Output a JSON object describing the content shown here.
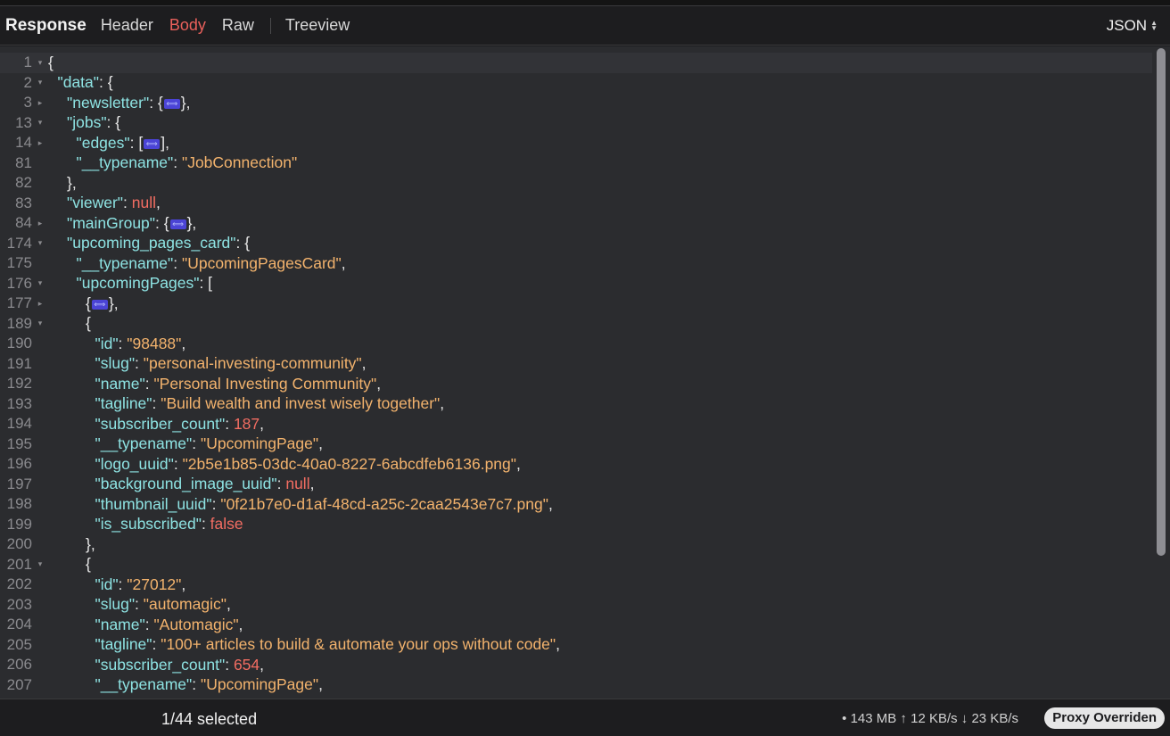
{
  "header": {
    "title": "Response",
    "tabs": [
      "Header",
      "Body",
      "Raw",
      "Treeview"
    ],
    "active_tab": "Body",
    "format": "JSON"
  },
  "editor": {
    "lines": [
      {
        "n": "1",
        "fold": "▾",
        "indent": 0,
        "tokens": [
          [
            "p",
            "{"
          ]
        ]
      },
      {
        "n": "2",
        "fold": "▾",
        "indent": 1,
        "tokens": [
          [
            "k",
            "\"data\""
          ],
          [
            "p",
            ": {"
          ]
        ]
      },
      {
        "n": "3",
        "fold": "▸",
        "indent": 2,
        "tokens": [
          [
            "k",
            "\"newsletter\""
          ],
          [
            "p",
            ": {"
          ],
          [
            "c",
            ""
          ],
          [
            "p",
            "},"
          ]
        ]
      },
      {
        "n": "13",
        "fold": "▾",
        "indent": 2,
        "tokens": [
          [
            "k",
            "\"jobs\""
          ],
          [
            "p",
            ": {"
          ]
        ]
      },
      {
        "n": "14",
        "fold": "▸",
        "indent": 3,
        "tokens": [
          [
            "k",
            "\"edges\""
          ],
          [
            "p",
            ": ["
          ],
          [
            "c",
            ""
          ],
          [
            "p",
            "],"
          ]
        ]
      },
      {
        "n": "81",
        "fold": "",
        "indent": 3,
        "tokens": [
          [
            "k",
            "\"__typename\""
          ],
          [
            "p",
            ": "
          ],
          [
            "s",
            "\"JobConnection\""
          ]
        ]
      },
      {
        "n": "82",
        "fold": "",
        "indent": 2,
        "tokens": [
          [
            "p",
            "},"
          ]
        ]
      },
      {
        "n": "83",
        "fold": "",
        "indent": 2,
        "tokens": [
          [
            "k",
            "\"viewer\""
          ],
          [
            "p",
            ": "
          ],
          [
            "n",
            "null"
          ],
          [
            "p",
            ","
          ]
        ]
      },
      {
        "n": "84",
        "fold": "▸",
        "indent": 2,
        "tokens": [
          [
            "k",
            "\"mainGroup\""
          ],
          [
            "p",
            ": {"
          ],
          [
            "c",
            ""
          ],
          [
            "p",
            "},"
          ]
        ]
      },
      {
        "n": "174",
        "fold": "▾",
        "indent": 2,
        "tokens": [
          [
            "k",
            "\"upcoming_pages_card\""
          ],
          [
            "p",
            ": {"
          ]
        ]
      },
      {
        "n": "175",
        "fold": "",
        "indent": 3,
        "tokens": [
          [
            "k",
            "\"__typename\""
          ],
          [
            "p",
            ": "
          ],
          [
            "s",
            "\"UpcomingPagesCard\""
          ],
          [
            "p",
            ","
          ]
        ]
      },
      {
        "n": "176",
        "fold": "▾",
        "indent": 3,
        "tokens": [
          [
            "k",
            "\"upcomingPages\""
          ],
          [
            "p",
            ": ["
          ]
        ]
      },
      {
        "n": "177",
        "fold": "▸",
        "indent": 4,
        "tokens": [
          [
            "p",
            "{"
          ],
          [
            "c",
            ""
          ],
          [
            "p",
            "},"
          ]
        ]
      },
      {
        "n": "189",
        "fold": "▾",
        "indent": 4,
        "tokens": [
          [
            "p",
            "{"
          ]
        ]
      },
      {
        "n": "190",
        "fold": "",
        "indent": 5,
        "tokens": [
          [
            "k",
            "\"id\""
          ],
          [
            "p",
            ": "
          ],
          [
            "s",
            "\"98488\""
          ],
          [
            "p",
            ","
          ]
        ]
      },
      {
        "n": "191",
        "fold": "",
        "indent": 5,
        "tokens": [
          [
            "k",
            "\"slug\""
          ],
          [
            "p",
            ": "
          ],
          [
            "s",
            "\"personal-investing-community\""
          ],
          [
            "p",
            ","
          ]
        ]
      },
      {
        "n": "192",
        "fold": "",
        "indent": 5,
        "tokens": [
          [
            "k",
            "\"name\""
          ],
          [
            "p",
            ": "
          ],
          [
            "s",
            "\"Personal Investing Community\""
          ],
          [
            "p",
            ","
          ]
        ]
      },
      {
        "n": "193",
        "fold": "",
        "indent": 5,
        "tokens": [
          [
            "k",
            "\"tagline\""
          ],
          [
            "p",
            ": "
          ],
          [
            "s",
            "\"Build wealth and invest wisely together\""
          ],
          [
            "p",
            ","
          ]
        ]
      },
      {
        "n": "194",
        "fold": "",
        "indent": 5,
        "tokens": [
          [
            "k",
            "\"subscriber_count\""
          ],
          [
            "p",
            ": "
          ],
          [
            "n",
            "187"
          ],
          [
            "p",
            ","
          ]
        ]
      },
      {
        "n": "195",
        "fold": "",
        "indent": 5,
        "tokens": [
          [
            "k",
            "\"__typename\""
          ],
          [
            "p",
            ": "
          ],
          [
            "s",
            "\"UpcomingPage\""
          ],
          [
            "p",
            ","
          ]
        ]
      },
      {
        "n": "196",
        "fold": "",
        "indent": 5,
        "tokens": [
          [
            "k",
            "\"logo_uuid\""
          ],
          [
            "p",
            ": "
          ],
          [
            "s",
            "\"2b5e1b85-03dc-40a0-8227-6abcdfeb6136.png\""
          ],
          [
            "p",
            ","
          ]
        ]
      },
      {
        "n": "197",
        "fold": "",
        "indent": 5,
        "tokens": [
          [
            "k",
            "\"background_image_uuid\""
          ],
          [
            "p",
            ": "
          ],
          [
            "n",
            "null"
          ],
          [
            "p",
            ","
          ]
        ]
      },
      {
        "n": "198",
        "fold": "",
        "indent": 5,
        "tokens": [
          [
            "k",
            "\"thumbnail_uuid\""
          ],
          [
            "p",
            ": "
          ],
          [
            "s",
            "\"0f21b7e0-d1af-48cd-a25c-2caa2543e7c7.png\""
          ],
          [
            "p",
            ","
          ]
        ]
      },
      {
        "n": "199",
        "fold": "",
        "indent": 5,
        "tokens": [
          [
            "k",
            "\"is_subscribed\""
          ],
          [
            "p",
            ": "
          ],
          [
            "n",
            "false"
          ]
        ]
      },
      {
        "n": "200",
        "fold": "",
        "indent": 4,
        "tokens": [
          [
            "p",
            "},"
          ]
        ]
      },
      {
        "n": "201",
        "fold": "▾",
        "indent": 4,
        "tokens": [
          [
            "p",
            "{"
          ]
        ]
      },
      {
        "n": "202",
        "fold": "",
        "indent": 5,
        "tokens": [
          [
            "k",
            "\"id\""
          ],
          [
            "p",
            ": "
          ],
          [
            "s",
            "\"27012\""
          ],
          [
            "p",
            ","
          ]
        ]
      },
      {
        "n": "203",
        "fold": "",
        "indent": 5,
        "tokens": [
          [
            "k",
            "\"slug\""
          ],
          [
            "p",
            ": "
          ],
          [
            "s",
            "\"automagic\""
          ],
          [
            "p",
            ","
          ]
        ]
      },
      {
        "n": "204",
        "fold": "",
        "indent": 5,
        "tokens": [
          [
            "k",
            "\"name\""
          ],
          [
            "p",
            ": "
          ],
          [
            "s",
            "\"Automagic\""
          ],
          [
            "p",
            ","
          ]
        ]
      },
      {
        "n": "205",
        "fold": "",
        "indent": 5,
        "tokens": [
          [
            "k",
            "\"tagline\""
          ],
          [
            "p",
            ": "
          ],
          [
            "s",
            "\"100+ articles to build & automate your ops without code\""
          ],
          [
            "p",
            ","
          ]
        ]
      },
      {
        "n": "206",
        "fold": "",
        "indent": 5,
        "tokens": [
          [
            "k",
            "\"subscriber_count\""
          ],
          [
            "p",
            ": "
          ],
          [
            "n",
            "654"
          ],
          [
            "p",
            ","
          ]
        ]
      },
      {
        "n": "207",
        "fold": "",
        "indent": 5,
        "tokens": [
          [
            "k",
            "\"__typename\""
          ],
          [
            "p",
            ": "
          ],
          [
            "s",
            "\"UpcomingPage\""
          ],
          [
            "p",
            ","
          ]
        ]
      }
    ]
  },
  "footer": {
    "selected": "1/44 selected",
    "stats": "• 143 MB ↑ 12 KB/s ↓ 23 KB/s",
    "badge": "Proxy Overriden"
  },
  "icons": {
    "collapsed": "⟺",
    "format_chevron": "updown-chevron-icon"
  },
  "colors": {
    "key": "#8ee3e3",
    "string": "#f3b36d",
    "literal": "#f26d62",
    "active_tab": "#e9605b",
    "editor_bg": "#2b2c2f"
  }
}
